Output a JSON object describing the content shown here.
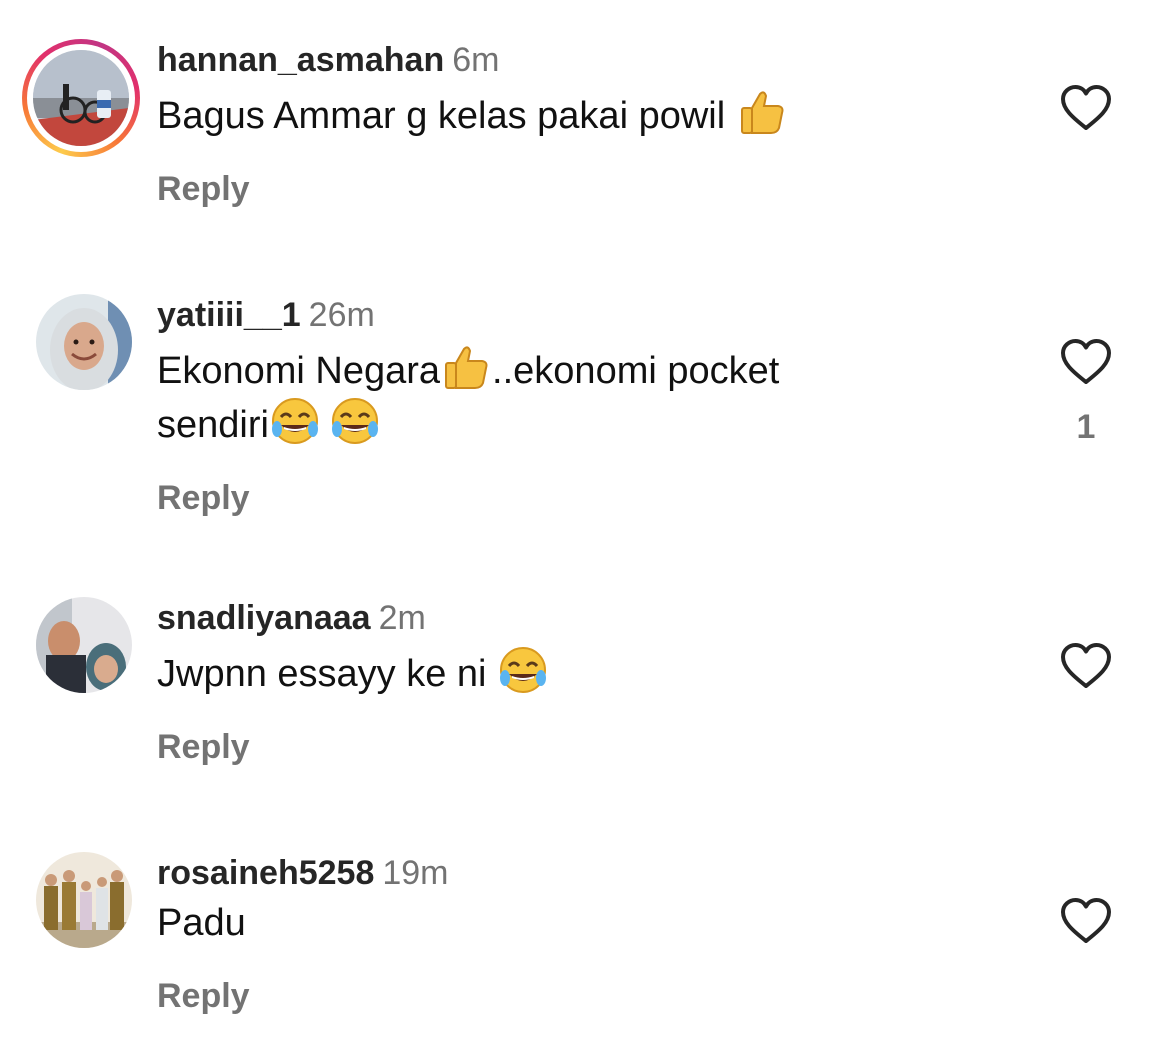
{
  "comments": [
    {
      "username": "hannan_asmahan",
      "time": "6m",
      "text_before": "Bagus Ammar g kelas pakai powil ",
      "emoji_1": "thumbs-up",
      "reply_label": "Reply",
      "has_story": true
    },
    {
      "username": "yatiiii__1",
      "time": "26m",
      "text_before": "Ekonomi Negara",
      "emoji_1": "thumbs-up",
      "text_after": "..ekonomi pocket",
      "text_line2": "sendiri",
      "emoji_2": "face-with-tears-of-joy",
      "emoji_3": "face-with-tears-of-joy",
      "like_count": "1",
      "reply_label": "Reply"
    },
    {
      "username": "snadliyanaaa",
      "time": "2m",
      "text_before": "Jwpnn essayy ke ni ",
      "emoji_1": "face-with-tears-of-joy",
      "reply_label": "Reply"
    },
    {
      "username": "rosaineh5258",
      "time": "19m",
      "text_before": "Padu",
      "reply_label": "Reply"
    }
  ],
  "colors": {
    "username": "#262626",
    "secondary": "#737373",
    "text": "#111111"
  }
}
